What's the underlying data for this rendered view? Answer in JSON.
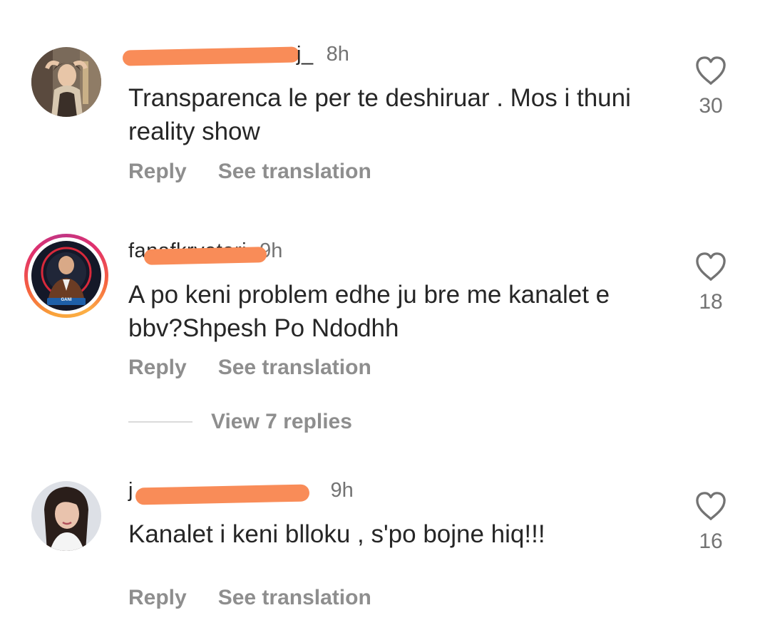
{
  "comments": [
    {
      "username": "j_",
      "time": "8h",
      "text": "Transparenca le per te deshiruar . Mos i thuni reality show",
      "likes": "30",
      "reply_label": "Reply",
      "translate_label": "See translation"
    },
    {
      "username": "fanafkryetari",
      "time": "9h",
      "text": "A po keni problem edhe  ju bre me kanalet e bbv?Shpesh Po Ndodhh",
      "likes": "18",
      "reply_label": "Reply",
      "translate_label": "See translation",
      "view_replies": "View 7 replies",
      "avatar_badge": "GANI"
    },
    {
      "username": "j",
      "time": "9h",
      "text": "Kanalet i keni blloku , s'po bojne hiq!!!",
      "likes": "16",
      "reply_label": "Reply",
      "translate_label": "See translation"
    }
  ],
  "colors": {
    "text": "#262626",
    "secondary": "#737373",
    "action": "#8e8e8e",
    "redaction": "#f98c58"
  },
  "icons": {
    "like": "heart-outline-icon"
  }
}
